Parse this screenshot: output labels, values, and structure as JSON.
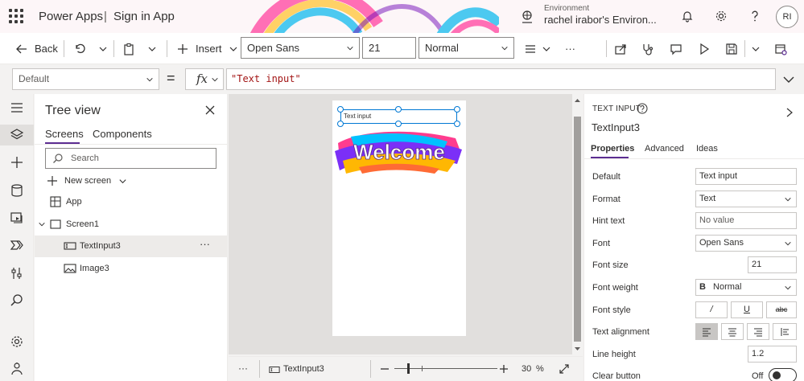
{
  "header": {
    "app_name": "Power Apps",
    "separator": "|",
    "app_title": "Sign in App",
    "env_label": "Environment",
    "env_name": "rachel irabor's Environ...",
    "avatar_initials": "RI"
  },
  "toolbar": {
    "back_label": "Back",
    "insert_label": "Insert",
    "font": "Open Sans",
    "font_size": "21",
    "font_weight": "Normal",
    "more": "···"
  },
  "formula": {
    "property": "Default",
    "equals": "=",
    "fx": "fx",
    "value": "\"Text input\""
  },
  "tree": {
    "title": "Tree view",
    "tabs": [
      "Screens",
      "Components"
    ],
    "search_placeholder": "Search",
    "new_screen_label": "New screen",
    "items": [
      {
        "label": "App"
      },
      {
        "label": "Screen1"
      },
      {
        "label": "TextInput3",
        "more": "···"
      },
      {
        "label": "Image3"
      }
    ]
  },
  "canvas": {
    "textinput_text": "Text input",
    "welcome_text": "Welcome"
  },
  "statusbar": {
    "more": "···",
    "selected_control": "TextInput3",
    "zoom_value": "30",
    "zoom_unit": "%",
    "zoom_level_percent": 30
  },
  "props": {
    "kind": "TEXT INPUT",
    "control_name": "TextInput3",
    "tabs": [
      "Properties",
      "Advanced",
      "Ideas"
    ],
    "rows": {
      "default_label": "Default",
      "default_value": "Text input",
      "format_label": "Format",
      "format_value": "Text",
      "hint_label": "Hint text",
      "hint_placeholder": "No value",
      "font_label": "Font",
      "font_value": "Open Sans",
      "font_size_label": "Font size",
      "font_size_value": "21",
      "font_weight_label": "Font weight",
      "font_weight_prefix": "B",
      "font_weight_value": "Normal",
      "font_style_label": "Font style",
      "italic": "/",
      "underline": "U",
      "strike": "abc",
      "text_align_label": "Text alignment",
      "line_height_label": "Line height",
      "line_height_value": "1.2",
      "clear_button_label": "Clear button",
      "clear_button_value": "Off"
    }
  },
  "colors": {
    "accent": "#5c2d91",
    "selection": "#0078d4",
    "formula_string": "#a31515"
  }
}
